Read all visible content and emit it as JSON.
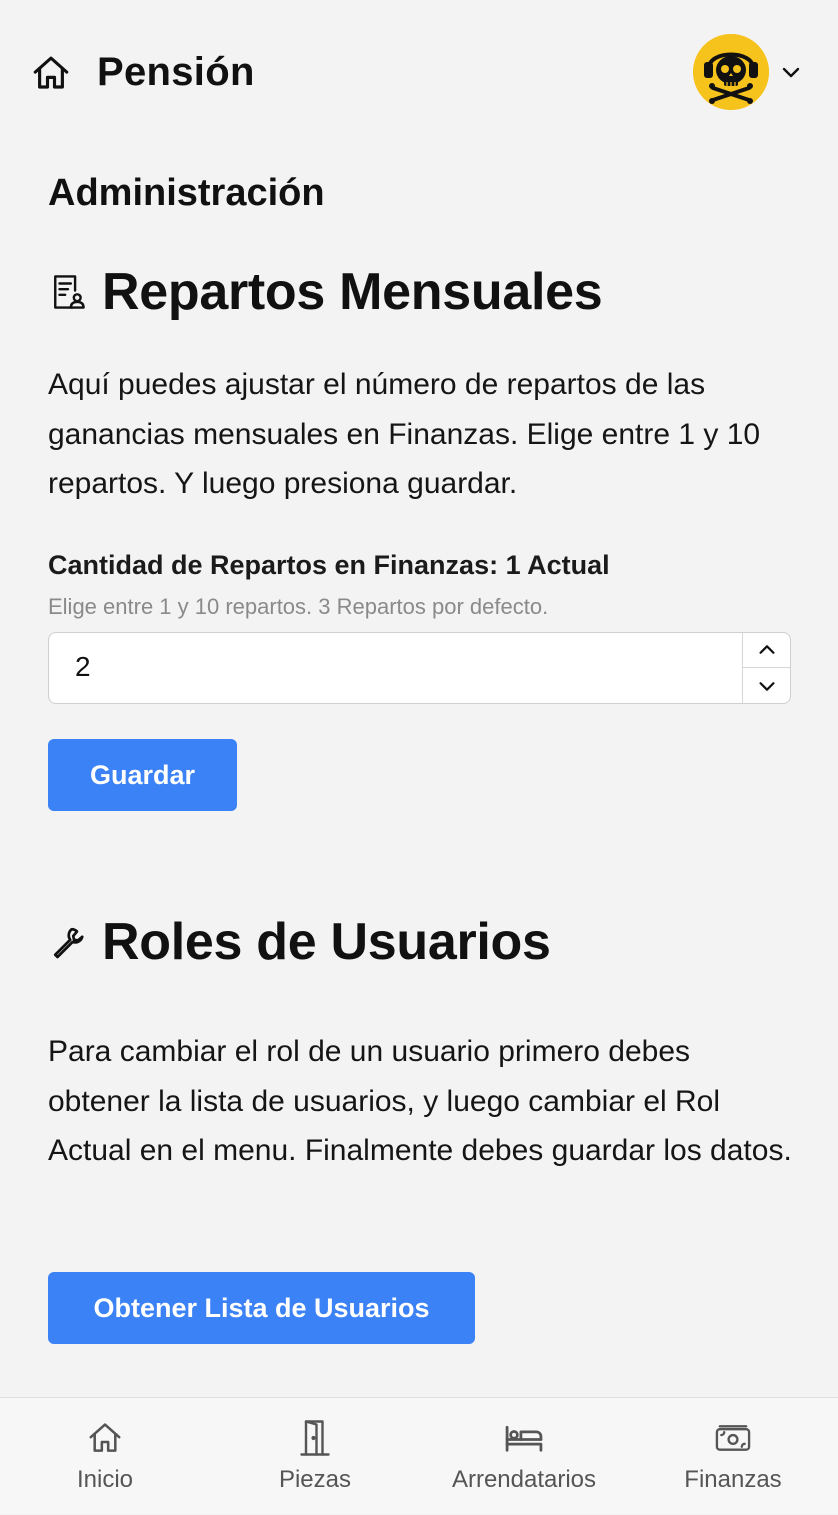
{
  "header": {
    "title": "Pensión",
    "home_icon": "home-icon",
    "avatar_icon": "skull-headphones-avatar",
    "menu_icon": "chevron-down-icon"
  },
  "page": {
    "section_title": "Administración"
  },
  "repartos": {
    "heading": "Repartos Mensuales",
    "icon": "document-user-icon",
    "description": "Aquí puedes ajustar el número de repartos de las ganancias mensuales en Finanzas. Elige entre 1 y 10 repartos. Y luego presiona guardar.",
    "field_label": "Cantidad de Repartos en Finanzas: 1 Actual",
    "field_hint": "Elige entre 1 y 10 repartos. 3 Repartos por defecto.",
    "field_value": "2",
    "save_label": "Guardar"
  },
  "roles": {
    "heading": "Roles de Usuarios",
    "icon": "wrench-icon",
    "description": "Para cambiar el rol de un usuario primero debes obtener la lista de usuarios, y luego cambiar el Rol Actual en el menu. Finalmente debes guardar los datos.",
    "fetch_label": "Obtener Lista de Usuarios"
  },
  "nav": {
    "items": [
      {
        "label": "Inicio",
        "icon": "home-icon"
      },
      {
        "label": "Piezas",
        "icon": "door-icon"
      },
      {
        "label": "Arrendatarios",
        "icon": "bed-icon"
      },
      {
        "label": "Finanzas",
        "icon": "cash-icon"
      }
    ]
  },
  "colors": {
    "accent": "#3b82f6",
    "background": "#f3f3f3",
    "avatar_bg": "#f6c21c"
  }
}
